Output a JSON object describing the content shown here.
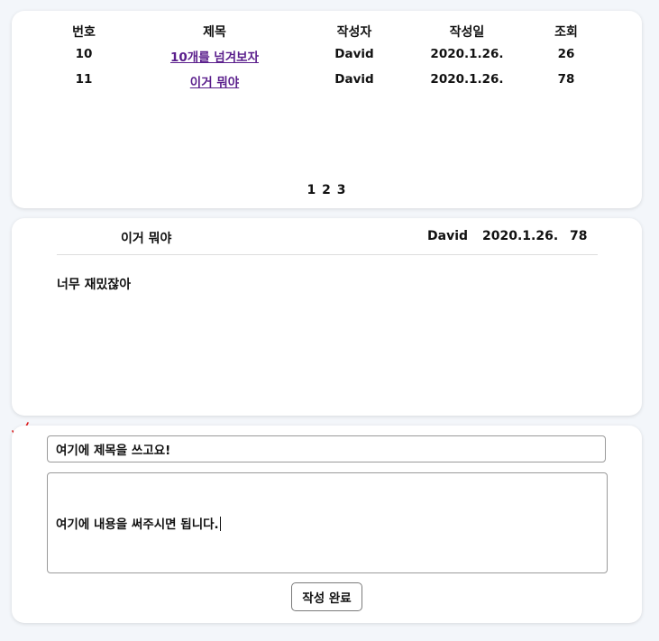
{
  "board": {
    "headers": {
      "no": "번호",
      "title": "제목",
      "author": "작성자",
      "date": "작성일",
      "views": "조회"
    },
    "rows": [
      {
        "no": "10",
        "title": "10개를 넘겨보자",
        "author": "David",
        "date": "2020.1.26.",
        "views": "26"
      },
      {
        "no": "11",
        "title": "이거 뭐야",
        "author": "David",
        "date": "2020.1.26.",
        "views": "78"
      }
    ],
    "pagination": "1 2 3"
  },
  "detail": {
    "title": "이거 뭐야",
    "author": "David",
    "date": "2020.1.26.",
    "views": "78",
    "content": "너무 재밌잖아"
  },
  "form": {
    "title_value": "여기에 제목을 쓰고요!",
    "content_value": "여기에 내용을 써주시면 됩니다.",
    "submit_label": "작성 완료"
  },
  "colors": {
    "link": "#5a1e8c",
    "annotation_mark": "#e01818"
  }
}
